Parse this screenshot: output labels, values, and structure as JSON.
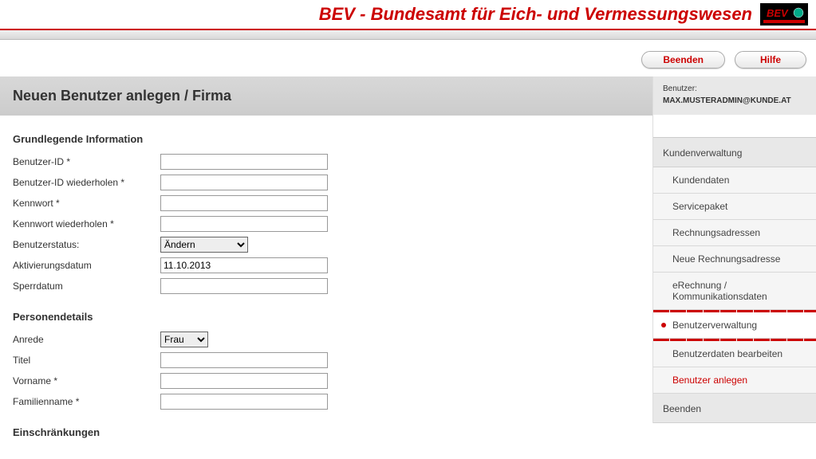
{
  "header": {
    "title": "BEV - Bundesamt für Eich- und Vermessungswesen",
    "logo_text": "BEV"
  },
  "top_buttons": {
    "beenden": "Beenden",
    "hilfe": "Hilfe"
  },
  "page_title": "Neuen Benutzer anlegen / Firma",
  "form": {
    "section1": "Grundlegende Information",
    "benutzer_id_label": "Benutzer-ID *",
    "benutzer_id_value": "",
    "benutzer_id_wdh_label": "Benutzer-ID wiederholen *",
    "benutzer_id_wdh_value": "",
    "kennwort_label": "Kennwort *",
    "kennwort_value": "",
    "kennwort_wdh_label": "Kennwort wiederholen *",
    "kennwort_wdh_value": "",
    "benutzerstatus_label": "Benutzerstatus:",
    "benutzerstatus_value": "Ändern",
    "aktivierungsdatum_label": "Aktivierungsdatum",
    "aktivierungsdatum_value": "11.10.2013",
    "sperrdatum_label": "Sperrdatum",
    "sperrdatum_value": "",
    "section2": "Personendetails",
    "anrede_label": "Anrede",
    "anrede_value": "Frau",
    "titel_label": "Titel",
    "titel_value": "",
    "vorname_label": "Vorname *",
    "vorname_value": "",
    "familienname_label": "Familienname *",
    "familienname_value": "",
    "section3": "Einschränkungen"
  },
  "sidebar": {
    "user_label": "Benutzer:",
    "user_value": "MAX.MUSTERADMIN@KUNDE.AT",
    "nav_head1": "Kundenverwaltung",
    "items1": [
      "Kundendaten",
      "Servicepaket",
      "Rechnungsadressen",
      "Neue Rechnungsadresse",
      "eRechnung / Kommunikationsdaten"
    ],
    "active_item": "Benutzerverwaltung",
    "items2": [
      "Benutzerdaten bearbeiten",
      "Benutzer anlegen"
    ],
    "nav_head2": "Beenden"
  }
}
